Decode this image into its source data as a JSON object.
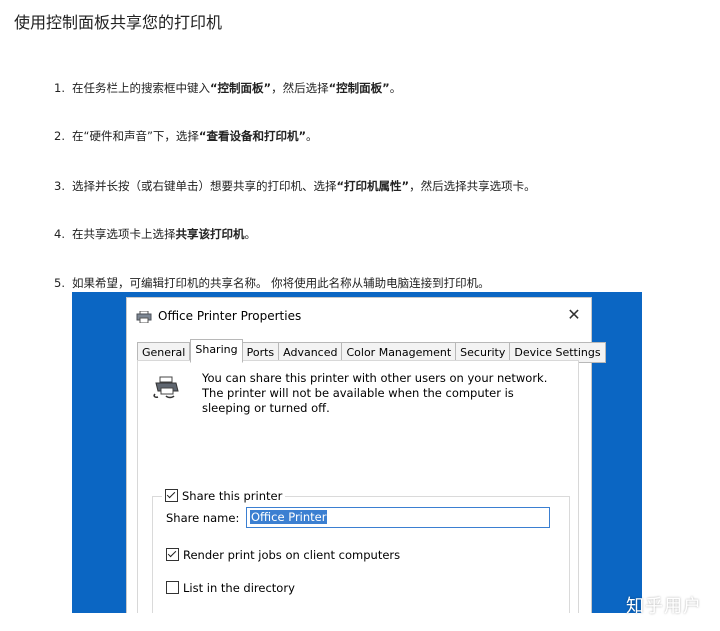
{
  "article": {
    "title": "使用控制面板共享您的打印机",
    "steps": [
      {
        "num": "1.",
        "pre": "在任务栏上的搜索框中键入",
        "b1": "“控制面板”",
        "mid": "，然后选择",
        "b2": "“控制面板”",
        "post": "。"
      },
      {
        "num": "2.",
        "pre": "在“硬件和声音”下，选择",
        "b1": "“查看设备和打印机”",
        "post": "。"
      },
      {
        "num": "3.",
        "pre": "选择并长按（或右键单击）想要共享的打印机、选择",
        "b1": "“打印机属性”",
        "post": "，然后选择共享选项卡。"
      },
      {
        "num": "4.",
        "pre": "在共享选项卡上选择",
        "b1": "共享该打印机",
        "post": "。"
      },
      {
        "num": "5.",
        "pre": "如果希望，可编辑打印机的共享名称。 你将使用此名称从辅助电脑连接到打印机。"
      }
    ]
  },
  "dialog": {
    "title": "Office Printer Properties",
    "title_icon": "printer-icon",
    "close_glyph": "✕",
    "tabs": [
      {
        "label": "General",
        "active": false
      },
      {
        "label": "Sharing",
        "active": true
      },
      {
        "label": "Ports",
        "active": false
      },
      {
        "label": "Advanced",
        "active": false
      },
      {
        "label": "Color Management",
        "active": false
      },
      {
        "label": "Security",
        "active": false
      },
      {
        "label": "Device Settings",
        "active": false
      }
    ],
    "info_icon": "shared-printer-icon",
    "info_text": "You can share this printer with other users on your network. The printer will not be available when the computer is sleeping or turned off.",
    "share_printer_label": "Share this printer",
    "share_printer_checked": true,
    "share_name_label": "Share name:",
    "share_name_value": "Office Printer",
    "render_jobs_label": "Render print jobs on client computers",
    "render_jobs_checked": true,
    "list_directory_label": "List in the directory",
    "list_directory_checked": false
  },
  "colors": {
    "screenshot_background": "#0b66c3",
    "selection": "#3b7fd1"
  },
  "watermark": "知乎用户"
}
